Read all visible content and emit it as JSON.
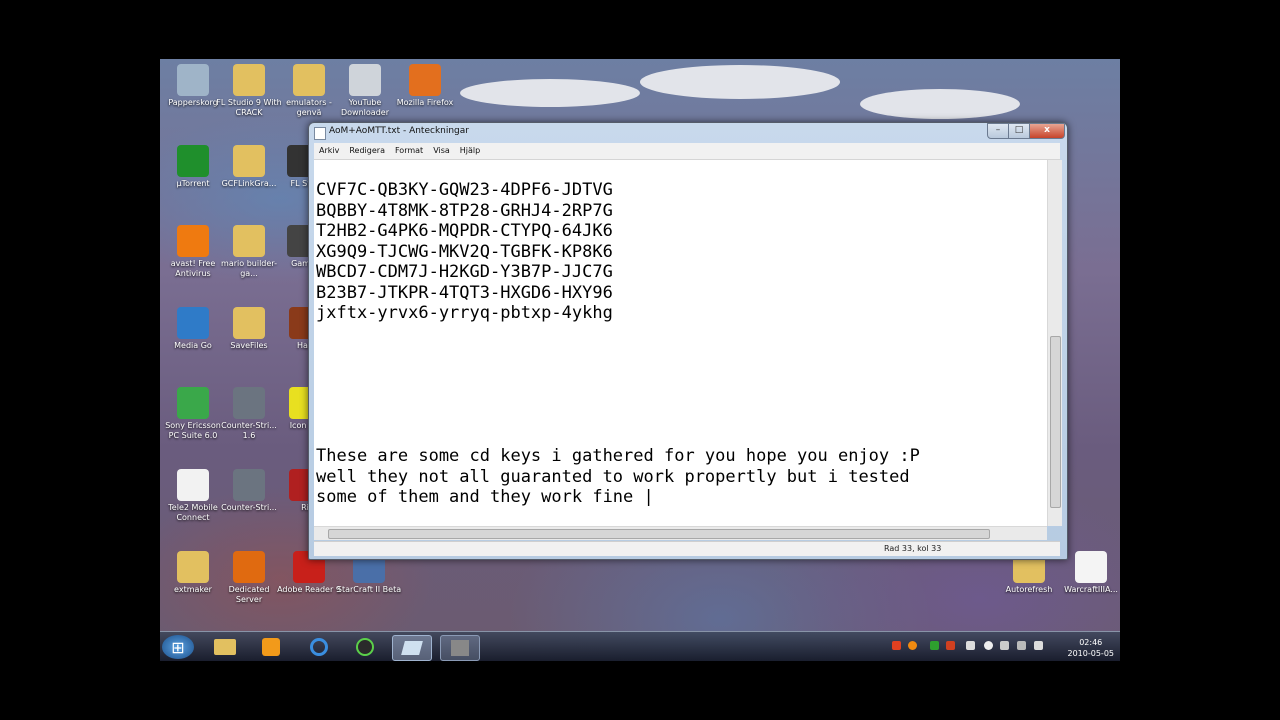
{
  "desktop": {
    "icons": [
      {
        "label": "Papperskorg",
        "color": "#9fb4c8"
      },
      {
        "label": "FL Studio 9 With CRACK",
        "color": "#e2c060"
      },
      {
        "label": "emulators - genvä",
        "color": "#e2c060"
      },
      {
        "label": "YouTube Downloader",
        "color": "#cfd4da"
      },
      {
        "label": "Mozilla Firefox",
        "color": "#e36f1e"
      },
      {
        "label": "µTorrent",
        "color": "#1f8f2c"
      },
      {
        "label": "GCFLinkGra...",
        "color": "#e2c060"
      },
      {
        "label": "FL Stu",
        "color": "#333333"
      },
      {
        "label": "avast! Free Antivirus",
        "color": "#ef7a10"
      },
      {
        "label": "mario builder-ga...",
        "color": "#e2c060"
      },
      {
        "label": "Game",
        "color": "#444444"
      },
      {
        "label": "Media Go",
        "color": "#2f7bc8"
      },
      {
        "label": "SaveFiles",
        "color": "#e2c060"
      },
      {
        "label": "Half",
        "color": "#8a3a1a"
      },
      {
        "label": "Sony Ericsson PC Suite 6.0",
        "color": "#3aa84a"
      },
      {
        "label": "Counter-Stri... 1.6",
        "color": "#6b7480"
      },
      {
        "label": "Icon (4)",
        "color": "#e8e020"
      },
      {
        "label": "Tele2 Mobile Connect",
        "color": "#f2f2f2"
      },
      {
        "label": "Counter-Stri...",
        "color": "#6b7480"
      },
      {
        "label": "Ri",
        "color": "#b02020"
      },
      {
        "label": "extmaker",
        "color": "#e2c060"
      },
      {
        "label": "Dedicated Server",
        "color": "#e06a10"
      },
      {
        "label": "Adobe Reader 9",
        "color": "#c8201a"
      },
      {
        "label": "StarCraft II Beta",
        "color": "#4a6fa8"
      },
      {
        "label": "Autorefresh",
        "color": "#e2c060"
      },
      {
        "label": "WarcraftIIIA...",
        "color": "#f4f4f4"
      }
    ]
  },
  "notepad": {
    "title": "AoM+AoMTT.txt - Anteckningar",
    "menu": [
      "Arkiv",
      "Redigera",
      "Format",
      "Visa",
      "Hjälp"
    ],
    "keys": "CVF7C-QB3KY-GQW23-4DPF6-JDTVG\nBQBBY-4T8MK-8TP28-GRHJ4-2RP7G\nT2HB2-G4PK6-MQPDR-CTYPQ-64JK6\nXG9Q9-TJCWG-MKV2Q-TGBFK-KP8K6\nWBCD7-CDM7J-H2KGD-Y3B7P-JJC7G\nB23B7-JTKPR-4TQT3-HXGD6-HXY96\njxftx-yrvx6-yrryq-pbtxp-4ykhg",
    "message": "These are some cd keys i gathered for you hope you enjoy :P\nwell they not all guaranted to work propertly but i tested\nsome of them and they work fine |",
    "status": "Rad 33, kol 33",
    "close_glyph": "x",
    "max_glyph": "□",
    "min_glyph": "–"
  },
  "taskbar": {
    "start_glyph": "⊞",
    "clock_time": "02:46",
    "clock_date": "2010-05-05"
  }
}
